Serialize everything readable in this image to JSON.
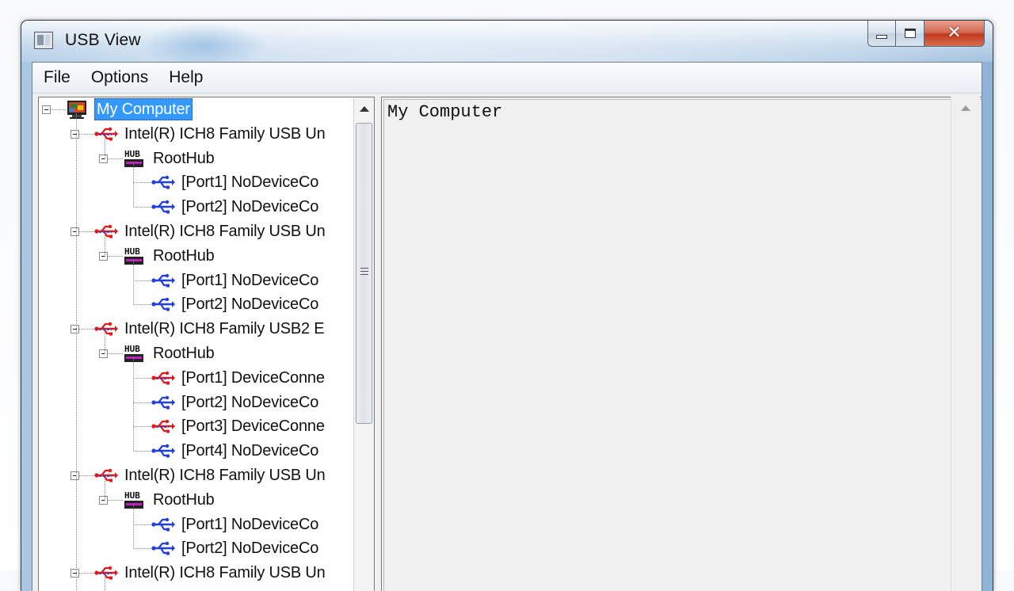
{
  "window": {
    "title": "USB View"
  },
  "menu": {
    "items": [
      "File",
      "Options",
      "Help"
    ]
  },
  "tree": {
    "nodes": [
      {
        "label": "My Computer",
        "icon": "computer-icon",
        "level": 0,
        "selected": true,
        "expander": true
      },
      {
        "label": "Intel(R) ICH8 Family USB Un",
        "icon": "usb-controller-icon",
        "level": 1,
        "expander": true
      },
      {
        "label": "RootHub",
        "icon": "hub-icon",
        "level": 2,
        "expander": true
      },
      {
        "label": "[Port1] NoDeviceCo",
        "icon": "usb-port-icon",
        "level": 3
      },
      {
        "label": "[Port2] NoDeviceCo",
        "icon": "usb-port-icon",
        "level": 3
      },
      {
        "label": "Intel(R) ICH8 Family USB Un",
        "icon": "usb-controller-icon",
        "level": 1,
        "expander": true
      },
      {
        "label": "RootHub",
        "icon": "hub-icon",
        "level": 2,
        "expander": true
      },
      {
        "label": "[Port1] NoDeviceCo",
        "icon": "usb-port-icon",
        "level": 3
      },
      {
        "label": "[Port2] NoDeviceCo",
        "icon": "usb-port-icon",
        "level": 3
      },
      {
        "label": "Intel(R) ICH8 Family USB2 E",
        "icon": "usb-controller-icon",
        "level": 1,
        "expander": true
      },
      {
        "label": "RootHub",
        "icon": "hub-icon",
        "level": 2,
        "expander": true
      },
      {
        "label": "[Port1] DeviceConne",
        "icon": "usb-device-icon",
        "level": 3
      },
      {
        "label": "[Port2] NoDeviceCo",
        "icon": "usb-port-icon",
        "level": 3
      },
      {
        "label": "[Port3] DeviceConne",
        "icon": "usb-device-icon",
        "level": 3
      },
      {
        "label": "[Port4] NoDeviceCo",
        "icon": "usb-port-icon",
        "level": 3
      },
      {
        "label": "Intel(R) ICH8 Family USB Un",
        "icon": "usb-controller-icon",
        "level": 1,
        "expander": true
      },
      {
        "label": "RootHub",
        "icon": "hub-icon",
        "level": 2,
        "expander": true
      },
      {
        "label": "[Port1] NoDeviceCo",
        "icon": "usb-port-icon",
        "level": 3
      },
      {
        "label": "[Port2] NoDeviceCo",
        "icon": "usb-port-icon",
        "level": 3
      },
      {
        "label": "Intel(R) ICH8 Family USB Un",
        "icon": "usb-controller-icon",
        "level": 1,
        "expander": true
      }
    ],
    "scroll_position": 0.0
  },
  "detail": {
    "text": "My Computer"
  },
  "colors": {
    "selection": "#3399ff",
    "usb_blue": "#1f3fe0",
    "usb_red": "#e01a1a"
  }
}
